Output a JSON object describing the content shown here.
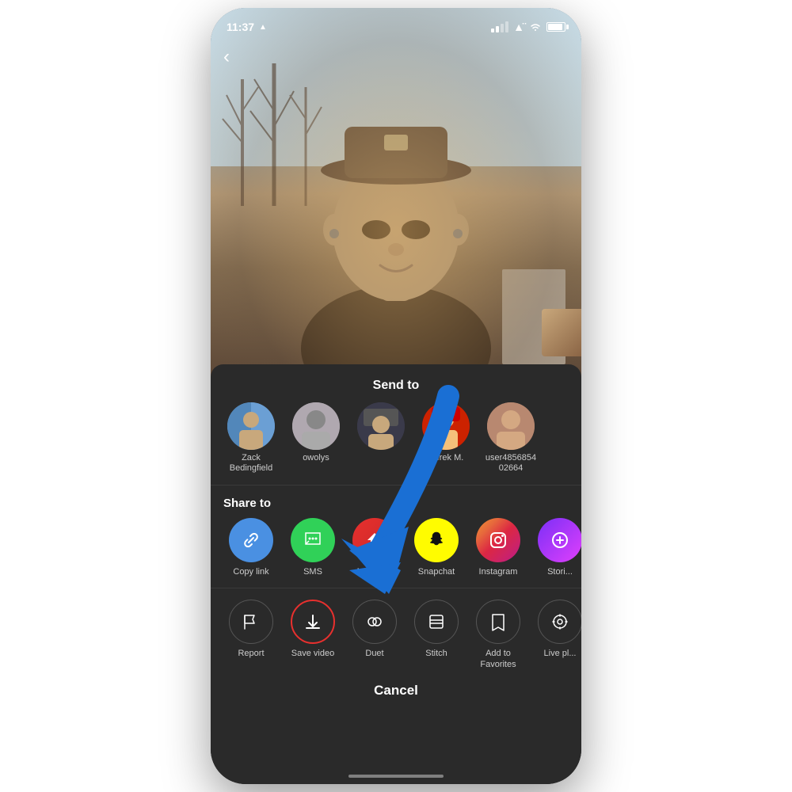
{
  "statusBar": {
    "time": "11:37",
    "locationArrow": "▲"
  },
  "video": {
    "backArrow": "‹"
  },
  "bottomSheet": {
    "sendToTitle": "Send to",
    "shareToTitle": "Share to",
    "contacts": [
      {
        "id": "zack",
        "name": "Zack\nBedingfield",
        "avatarClass": "avatar-zack",
        "emoji": "🧑"
      },
      {
        "id": "owolys",
        "name": "owolys",
        "avatarClass": "avatar-owolys",
        "emoji": "👤"
      },
      {
        "id": "third",
        "name": "",
        "avatarClass": "avatar-third",
        "emoji": "🧢"
      },
      {
        "id": "derek",
        "name": "Derek M.",
        "avatarClass": "avatar-derek",
        "emoji": "😊"
      },
      {
        "id": "user",
        "name": "user4856854\n02664",
        "avatarClass": "avatar-user",
        "emoji": "🧔"
      }
    ],
    "shareItems": [
      {
        "id": "copylink",
        "label": "Copy link",
        "iconClass": "icon-copylink",
        "icon": "🔗"
      },
      {
        "id": "sms",
        "label": "SMS",
        "iconClass": "icon-sms",
        "icon": "💬"
      },
      {
        "id": "message",
        "label": "Message",
        "iconClass": "icon-message",
        "icon": "✈"
      },
      {
        "id": "snapchat",
        "label": "Snapchat",
        "iconClass": "icon-snapchat",
        "icon": "👻"
      },
      {
        "id": "instagram",
        "label": "Instagram",
        "iconClass": "icon-instagram",
        "icon": "📷"
      },
      {
        "id": "stories",
        "label": "Stori...",
        "iconClass": "icon-stories",
        "icon": "➕"
      }
    ],
    "actionItems": [
      {
        "id": "report",
        "label": "Report",
        "icon": "⚑",
        "highlighted": false
      },
      {
        "id": "savevideo",
        "label": "Save video",
        "icon": "⬇",
        "highlighted": true
      },
      {
        "id": "duet",
        "label": "Duet",
        "icon": "◎",
        "highlighted": false
      },
      {
        "id": "stitch",
        "label": "Stitch",
        "icon": "⊟",
        "highlighted": false
      },
      {
        "id": "favorites",
        "label": "Add to\nFavorites",
        "icon": "🔖",
        "highlighted": false
      },
      {
        "id": "liveph",
        "label": "Live pl...",
        "icon": "◈",
        "highlighted": false
      }
    ],
    "cancelLabel": "Cancel"
  }
}
